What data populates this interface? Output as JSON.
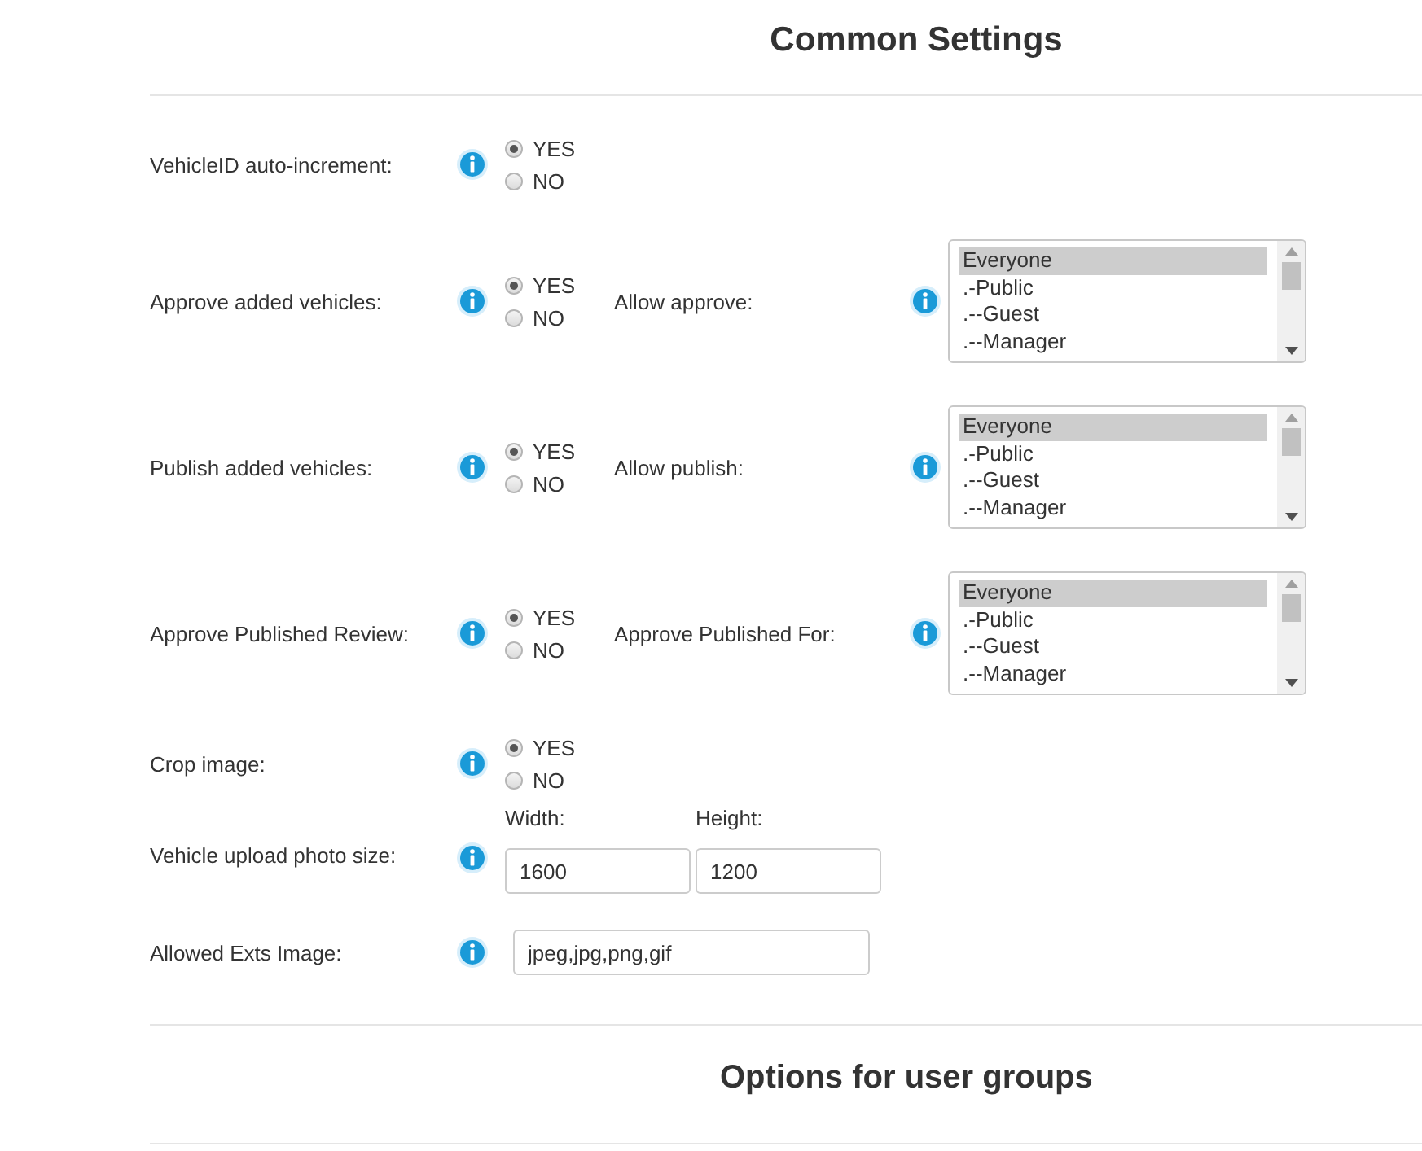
{
  "title": "Common Settings",
  "rows": [
    {
      "kind": "radio",
      "label": "VehicleID auto-increment:",
      "options": [
        {
          "label": "YES",
          "selected": true
        },
        {
          "label": "NO",
          "selected": false
        }
      ]
    },
    {
      "kind": "radio",
      "label": "Approve added vehicles:",
      "options": [
        {
          "label": "YES",
          "selected": true
        },
        {
          "label": "NO",
          "selected": false
        }
      ],
      "side": {
        "label": "Allow approve:",
        "items": [
          {
            "label": "Everyone",
            "selected": true
          },
          {
            "label": ".-Public",
            "selected": false
          },
          {
            "label": ".--Guest",
            "selected": false
          },
          {
            "label": ".--Manager",
            "selected": false
          }
        ]
      }
    },
    {
      "kind": "radio",
      "label": "Publish added vehicles:",
      "options": [
        {
          "label": "YES",
          "selected": true
        },
        {
          "label": "NO",
          "selected": false
        }
      ],
      "side": {
        "label": "Allow publish:",
        "items": [
          {
            "label": "Everyone",
            "selected": true
          },
          {
            "label": ".-Public",
            "selected": false
          },
          {
            "label": ".--Guest",
            "selected": false
          },
          {
            "label": ".--Manager",
            "selected": false
          }
        ]
      }
    },
    {
      "kind": "radio",
      "label": "Approve Published Review:",
      "options": [
        {
          "label": "YES",
          "selected": true
        },
        {
          "label": "NO",
          "selected": false
        }
      ],
      "side": {
        "label": "Approve Published For:",
        "items": [
          {
            "label": "Everyone",
            "selected": true
          },
          {
            "label": ".-Public",
            "selected": false
          },
          {
            "label": ".--Guest",
            "selected": false
          },
          {
            "label": ".--Manager",
            "selected": false
          }
        ]
      }
    },
    {
      "kind": "radio",
      "label": "Crop image:",
      "options": [
        {
          "label": "YES",
          "selected": true
        },
        {
          "label": "NO",
          "selected": false
        }
      ]
    },
    {
      "kind": "size",
      "label": "Vehicle upload photo size:",
      "fields": [
        {
          "label": "Width:",
          "value": "1600"
        },
        {
          "label": "Height:",
          "value": "1200"
        }
      ]
    },
    {
      "kind": "text",
      "label": "Allowed Exts Image:",
      "value": "jpeg,jpg,png,gif"
    }
  ],
  "footer_title": "Options for user groups"
}
